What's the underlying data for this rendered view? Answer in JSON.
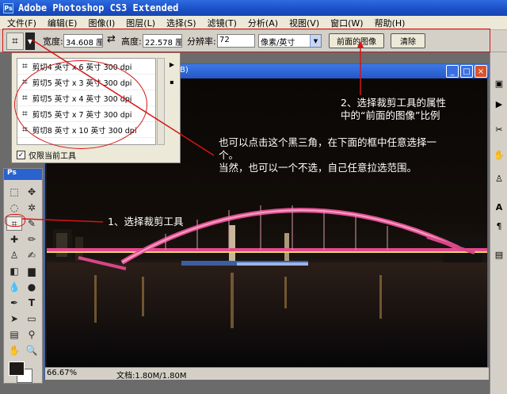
{
  "app": {
    "title": "Adobe Photoshop CS3 Extended",
    "ps_badge": "Ps"
  },
  "menu": {
    "items": [
      "文件(F)",
      "编辑(E)",
      "图像(I)",
      "图层(L)",
      "选择(S)",
      "滤镜(T)",
      "分析(A)",
      "视图(V)",
      "窗口(W)",
      "帮助(H)"
    ]
  },
  "options": {
    "width_label": "宽度:",
    "width_value": "34.608 厘",
    "swap_icon": "⇄",
    "height_label": "高度:",
    "height_value": "22.578 厘",
    "resolution_label": "分辨率:",
    "resolution_value": "72",
    "unit_value": "像素/英寸",
    "front_image_button": "前面的图像",
    "clear_button": "清除"
  },
  "presets": {
    "items": [
      "剪切4 英寸 x 6 英寸 300 dpi",
      "剪切5 英寸 x 3 英寸 300 dpi",
      "剪切5 英寸 x 4 英寸 300 dpi",
      "剪切5 英寸 x 7 英寸 300 dpi",
      "剪切8 英寸 x 10 英寸 300 dpi"
    ],
    "current_tool_only_label": "仅限当前工具"
  },
  "document": {
    "title_fragment": "B)",
    "zoom": "66.67%",
    "doc_info": "文档:1.80M/1.80M"
  },
  "toolbox": {
    "label": "Ps"
  },
  "annotations": {
    "a1": "1、选择裁剪工具",
    "a2_line1": "2、选择裁剪工具的属性",
    "a2_line2": "中的“前面的图像”比例",
    "a3_line1": "也可以点击这个黑三角，在下面的框中任意选择一",
    "a3_line2": "个。",
    "a3_line3": "当然，也可以一个不选，自己任意拉选范围。"
  },
  "colors": {
    "accent_red": "#d71414",
    "titlebar_blue": "#1a4fc4"
  }
}
